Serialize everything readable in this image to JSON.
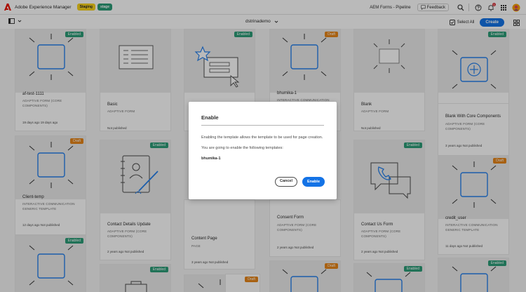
{
  "topbar": {
    "app_title": "Adobe Experience Manager",
    "env_badge_1": "Staging",
    "env_badge_2": "stage",
    "program": "AEM Forms - Pipeline",
    "feedback": "Feedback",
    "notification_count": "1"
  },
  "actionbar": {
    "folder": "dstrinademo",
    "select_all": "Select All",
    "create": "Create"
  },
  "cards": [
    {
      "title": "af-test-1111",
      "sub": "ADAPTIVE FORM (CORE COMPONENTS)",
      "meta": "19 days ago  19 days ago",
      "status": "Enabled"
    },
    {
      "title": "Basic",
      "sub": "ADAPTIVE FORM",
      "meta": "Not published",
      "status": ""
    },
    {
      "title": "",
      "sub": "",
      "meta": "",
      "status": "Enabled"
    },
    {
      "title": "bhumika-1",
      "sub": "INTERACTIVE COMMUNICATION",
      "meta": "",
      "status": "Draft"
    },
    {
      "title": "Blank",
      "sub": "ADAPTIVE FORM",
      "meta": "Not published",
      "status": ""
    },
    {
      "title": "",
      "sub": "",
      "meta": "",
      "status": "Enabled"
    },
    {
      "title": "Blank With Core Components",
      "sub": "ADAPTIVE FORM (CORE COMPONENTS)",
      "meta": "3 years ago  Not published",
      "status": "Enabled"
    },
    {
      "title": "Client-temp",
      "sub": "INTERACTIVE COMMUNICATION GENERIC TEMPLATE",
      "meta": "12 days ago  Not published",
      "status": "Draft"
    },
    {
      "title": "Contact Details Update",
      "sub": "ADAPTIVE FORM (CORE COMPONENTS)",
      "meta": "2 years ago  Not published",
      "status": "Enabled"
    },
    {
      "title": "Content Page",
      "sub": "PAGE",
      "meta": "3 years ago  Not published",
      "status": ""
    },
    {
      "title": "Consent Form",
      "sub": "ADAPTIVE FORM (CORE COMPONENTS)",
      "meta": "2 years ago  Not published",
      "status": ""
    },
    {
      "title": "Contact Us Form",
      "sub": "ADAPTIVE FORM (CORE COMPONENTS)",
      "meta": "2 years ago  Not published",
      "status": "Enabled"
    },
    {
      "title": "credit_user",
      "sub": "INTERACTIVE COMMUNICATION GENERIC TEMPLATE",
      "meta": "11 days ago  Not published",
      "status": "Draft"
    },
    {
      "title": "",
      "sub": "",
      "meta": "",
      "status": "Enabled"
    },
    {
      "title": "",
      "sub": "",
      "meta": "",
      "status": ""
    },
    {
      "title": "",
      "sub": "",
      "meta": "",
      "status": "Enabled"
    },
    {
      "title": "",
      "sub": "",
      "meta": "",
      "status": "Draft"
    },
    {
      "title": "",
      "sub": "",
      "meta": "",
      "status": "Draft"
    },
    {
      "title": "",
      "sub": "",
      "meta": "",
      "status": "Enabled"
    },
    {
      "title": "",
      "sub": "",
      "meta": "",
      "status": "Enabled"
    }
  ],
  "dialog": {
    "title": "Enable",
    "line1": "Enabling the template allows the template to be used for page creation.",
    "line2": "You are going to enable the following templates:",
    "item": "bhumika-1",
    "cancel": "Cancel",
    "enable": "Enable"
  },
  "colors": {
    "accent": "#1473e6",
    "enabled": "#2d9d78",
    "draft": "#e68619",
    "staging": "#f8d21e"
  }
}
